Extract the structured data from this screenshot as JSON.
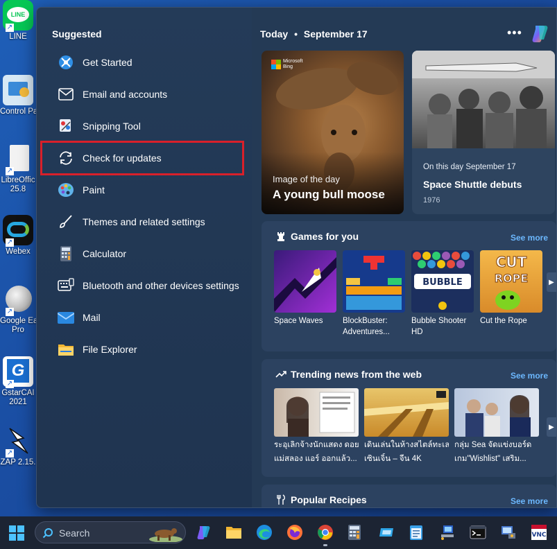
{
  "desktop": {
    "icons": [
      {
        "label": "LINE",
        "name": "line-app"
      },
      {
        "label": "Control Pa",
        "name": "control-panel"
      },
      {
        "label": "LibreOffic\n25.8",
        "name": "libreoffice"
      },
      {
        "label": "Webex",
        "name": "webex"
      },
      {
        "label": "Google Ea\nPro",
        "name": "google-earth-pro"
      },
      {
        "label": "GstarCAI\n2021",
        "name": "gstarcad"
      },
      {
        "label": "ZAP 2.15.",
        "name": "zap"
      }
    ]
  },
  "suggested": {
    "title": "Suggested",
    "items": [
      {
        "label": "Get Started",
        "icon": "get-started-icon"
      },
      {
        "label": "Email and accounts",
        "icon": "mail-outline-icon"
      },
      {
        "label": "Snipping Tool",
        "icon": "snipping-tool-icon"
      },
      {
        "label": "Check for updates",
        "icon": "sync-icon"
      },
      {
        "label": "Paint",
        "icon": "paint-palette-icon"
      },
      {
        "label": "Themes and related settings",
        "icon": "brush-icon"
      },
      {
        "label": "Calculator",
        "icon": "calculator-icon"
      },
      {
        "label": "Bluetooth and other devices settings",
        "icon": "keyboard-icon"
      },
      {
        "label": "Mail",
        "icon": "mail-icon"
      },
      {
        "label": "File Explorer",
        "icon": "folder-icon"
      }
    ]
  },
  "feed": {
    "date_label": "Today",
    "date": "September 17",
    "more": "•••",
    "image_of_day": {
      "brand_line1": "Microsoft",
      "brand_line2": "Bing",
      "small": "Image of the day",
      "title": "A young bull moose"
    },
    "on_this_day": {
      "small": "On this day September 17",
      "title": "Space Shuttle debuts",
      "year": "1976"
    },
    "games": {
      "title": "Games for you",
      "see_more": "See more",
      "items": [
        {
          "caption": "Space Waves"
        },
        {
          "caption": "BlockBuster:\nAdventures..."
        },
        {
          "caption": "Bubble Shooter\nHD"
        },
        {
          "caption": "Cut the Rope"
        }
      ]
    },
    "news": {
      "title": "Trending news from the web",
      "see_more": "See more",
      "items": [
        {
          "line1": "ระอุเลิกจ้างนักแสดง ดอย",
          "line2": "แม่สลอง แอร์ ออกแล้ว..."
        },
        {
          "line1": "เดินเล่นในห้างสไตล์ทะเล",
          "line2": "เซินเจิ้น – จีน 4K"
        },
        {
          "line1": "กลุ่ม Sea จัดแข่งบอร์ด",
          "line2": "เกม\"Wishlist\" เสริม..."
        }
      ]
    },
    "recipes": {
      "title": "Popular Recipes",
      "see_more": "See more"
    }
  },
  "taskbar": {
    "search_placeholder": "Search"
  }
}
